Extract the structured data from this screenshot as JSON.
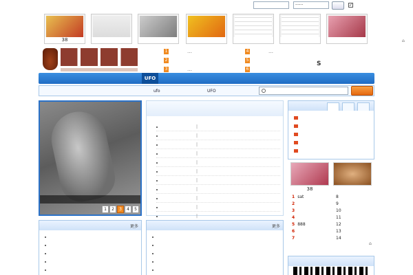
{
  "topbar": {
    "tagline": ""
  },
  "login": {
    "user_value": "",
    "password_mask": "······",
    "login_btn": "",
    "check_label": "",
    "register": ""
  },
  "thumbs": [
    {
      "caption": "38"
    },
    {
      "caption": ""
    },
    {
      "caption": ""
    },
    {
      "caption": ""
    },
    {
      "caption": ""
    },
    {
      "caption": ""
    },
    {
      "caption": ""
    },
    {
      "caption": ""
    }
  ],
  "top_mark": "⌂",
  "news": {
    "left": [
      {
        "num": "1",
        "text": "…"
      },
      {
        "num": "2",
        "text": ""
      },
      {
        "num": "3",
        "text": "…"
      }
    ],
    "right": [
      {
        "num": "4",
        "text": "…"
      },
      {
        "num": "5",
        "text": ""
      },
      {
        "num": "6",
        "text": ""
      }
    ],
    "s_mark": "S"
  },
  "right_links": [
    "",
    "",
    ""
  ],
  "nav": [
    "",
    "",
    "",
    "",
    "UFO",
    "",
    "",
    "",
    ""
  ],
  "subnav": [
    "",
    "",
    "",
    "",
    "",
    "ufo",
    "",
    "",
    "UFO",
    ""
  ],
  "search": {
    "placeholder": "",
    "button": ""
  },
  "slide": {
    "caption": "",
    "pages": [
      "1",
      "2",
      "3",
      "4",
      "5"
    ],
    "active": 2
  },
  "latest": {
    "title": "",
    "subtitle": "",
    "items": [
      {
        "cat": "",
        "title": ""
      },
      {
        "cat": "",
        "title": ""
      },
      {
        "cat": "",
        "title": ""
      },
      {
        "cat": "",
        "title": ""
      },
      {
        "cat": "",
        "title": ""
      },
      {
        "cat": "",
        "title": ""
      },
      {
        "cat": "",
        "title": ""
      },
      {
        "cat": "",
        "title": ""
      },
      {
        "cat": "",
        "title": ""
      },
      {
        "cat": "",
        "title": ""
      },
      {
        "cat": "",
        "title": ""
      }
    ]
  },
  "rank": {
    "title": "",
    "tabs": [
      "",
      "",
      ""
    ],
    "active_tab": 0
  },
  "pics": [
    {
      "caption": "38"
    },
    {
      "caption": ""
    }
  ],
  "grid2": [
    {
      "n": "1",
      "t": "sat"
    },
    {
      "n": "",
      "t": "8"
    },
    {
      "n": "2",
      "t": ""
    },
    {
      "n": "",
      "t": "9"
    },
    {
      "n": "3",
      "t": ""
    },
    {
      "n": "",
      "t": "10"
    },
    {
      "n": "4",
      "t": ""
    },
    {
      "n": "",
      "t": "11"
    },
    {
      "n": "5",
      "t": "888"
    },
    {
      "n": "",
      "t": "12"
    },
    {
      "n": "6",
      "t": ""
    },
    {
      "n": "",
      "t": "13"
    },
    {
      "n": "7",
      "t": ""
    },
    {
      "n": "",
      "t": "14"
    }
  ],
  "boxes": {
    "left": {
      "title": "",
      "more": "更多",
      "items": [
        "",
        "",
        "",
        "",
        ""
      ]
    },
    "mid": {
      "title": "",
      "more": "更多",
      "items": [
        "",
        "",
        "",
        "",
        ""
      ]
    },
    "right": {
      "title": ""
    }
  },
  "colors": {
    "nav": "#1f6cc4",
    "accent": "#f08a20",
    "border": "#a8c8e8"
  }
}
